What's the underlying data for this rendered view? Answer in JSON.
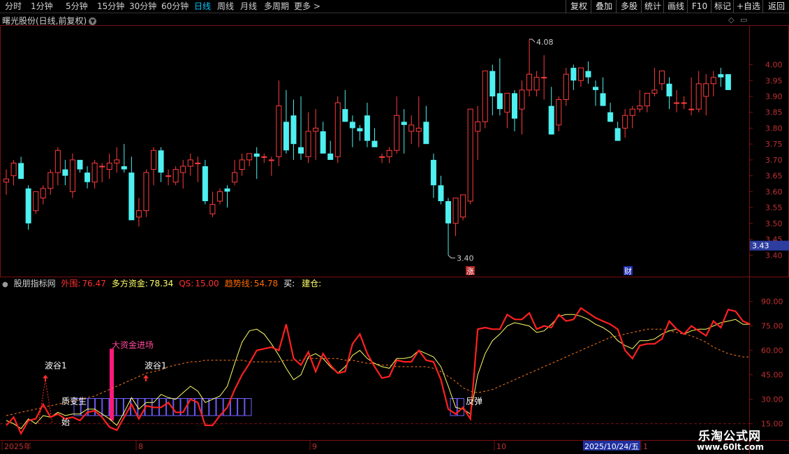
{
  "toolbar": {
    "left_items": [
      "分时",
      "1分钟",
      "5分钟",
      "15分钟",
      "30分钟",
      "60分钟",
      "日线",
      "周线",
      "月线",
      "多周期",
      "更多"
    ],
    "active_item": "日线",
    "right_buttons": [
      "复权",
      "叠加",
      "多股",
      "统计",
      "画线",
      "F10",
      "标记",
      "+自选",
      "返回"
    ]
  },
  "main_chart": {
    "title": "曙光股份(日线,前复权)",
    "price_labels": [
      "4.00",
      "3.95",
      "3.90",
      "3.85",
      "3.80",
      "3.75",
      "3.70",
      "3.65",
      "3.60",
      "3.55",
      "3.50",
      "3.45",
      "3.40"
    ],
    "current_price": "3.43",
    "high_marker": "4.08",
    "low_marker": "3.40",
    "event_badges": [
      "涨",
      "财"
    ],
    "colors": {
      "up": "#ff3c3c",
      "down": "#4ef0f0",
      "current_price_bg": "#2d3ea0"
    }
  },
  "candles": [
    [
      3.63,
      3.67,
      3.59,
      3.64
    ],
    [
      3.65,
      3.7,
      3.62,
      3.69
    ],
    [
      3.69,
      3.71,
      3.64,
      3.64
    ],
    [
      3.61,
      3.62,
      3.48,
      3.5
    ],
    [
      3.54,
      3.6,
      3.53,
      3.6
    ],
    [
      3.58,
      3.62,
      3.56,
      3.61
    ],
    [
      3.61,
      3.67,
      3.59,
      3.66
    ],
    [
      3.66,
      3.74,
      3.62,
      3.73
    ],
    [
      3.67,
      3.7,
      3.62,
      3.65
    ],
    [
      3.6,
      3.72,
      3.58,
      3.7
    ],
    [
      3.7,
      3.69,
      3.66,
      3.67
    ],
    [
      3.66,
      3.68,
      3.61,
      3.63
    ],
    [
      3.63,
      3.7,
      3.61,
      3.69
    ],
    [
      3.68,
      3.69,
      3.63,
      3.68
    ],
    [
      3.67,
      3.72,
      3.64,
      3.69
    ],
    [
      3.69,
      3.74,
      3.66,
      3.7
    ],
    [
      3.68,
      3.75,
      3.66,
      3.67
    ],
    [
      3.66,
      3.71,
      3.64,
      3.51
    ],
    [
      3.52,
      3.58,
      3.49,
      3.54
    ],
    [
      3.54,
      3.67,
      3.52,
      3.66
    ],
    [
      3.67,
      3.74,
      3.62,
      3.73
    ],
    [
      3.73,
      3.74,
      3.63,
      3.66
    ],
    [
      3.65,
      3.67,
      3.62,
      3.65
    ],
    [
      3.63,
      3.68,
      3.62,
      3.67
    ],
    [
      3.66,
      3.7,
      3.61,
      3.68
    ],
    [
      3.68,
      3.72,
      3.65,
      3.7
    ],
    [
      3.69,
      3.71,
      3.63,
      3.69
    ],
    [
      3.68,
      3.7,
      3.56,
      3.57
    ],
    [
      3.53,
      3.6,
      3.52,
      3.56
    ],
    [
      3.57,
      3.61,
      3.56,
      3.6
    ],
    [
      3.61,
      3.62,
      3.55,
      3.6
    ],
    [
      3.63,
      3.7,
      3.62,
      3.66
    ],
    [
      3.67,
      3.72,
      3.65,
      3.7
    ],
    [
      3.7,
      3.72,
      3.68,
      3.72
    ],
    [
      3.72,
      3.74,
      3.64,
      3.71
    ],
    [
      3.71,
      3.72,
      3.69,
      3.71
    ],
    [
      3.7,
      3.71,
      3.65,
      3.7
    ],
    [
      3.71,
      3.95,
      3.68,
      3.87
    ],
    [
      3.82,
      3.92,
      3.72,
      3.73
    ],
    [
      3.84,
      3.89,
      3.7,
      3.75
    ],
    [
      3.74,
      3.9,
      3.7,
      3.72
    ],
    [
      3.71,
      3.85,
      3.69,
      3.79
    ],
    [
      3.79,
      3.86,
      3.7,
      3.8
    ],
    [
      3.79,
      3.82,
      3.72,
      3.72
    ],
    [
      3.72,
      3.76,
      3.7,
      3.7
    ],
    [
      3.71,
      3.9,
      3.69,
      3.88
    ],
    [
      3.86,
      3.92,
      3.82,
      3.82
    ],
    [
      3.82,
      3.84,
      3.74,
      3.8
    ],
    [
      3.8,
      3.81,
      3.76,
      3.79
    ],
    [
      3.84,
      3.88,
      3.74,
      3.76
    ],
    [
      3.76,
      3.8,
      3.74,
      3.74
    ],
    [
      3.71,
      3.72,
      3.69,
      3.71
    ],
    [
      3.71,
      3.74,
      3.69,
      3.73
    ],
    [
      3.73,
      3.9,
      3.72,
      3.84
    ],
    [
      3.82,
      3.86,
      3.72,
      3.81
    ],
    [
      3.79,
      3.84,
      3.75,
      3.81
    ],
    [
      3.79,
      3.9,
      3.74,
      3.8
    ],
    [
      3.82,
      3.87,
      3.75,
      3.75
    ],
    [
      3.7,
      3.72,
      3.58,
      3.62
    ],
    [
      3.62,
      3.65,
      3.56,
      3.57
    ],
    [
      3.57,
      3.58,
      3.4,
      3.5
    ],
    [
      3.5,
      3.58,
      3.46,
      3.58
    ],
    [
      3.52,
      3.59,
      3.51,
      3.59
    ],
    [
      3.57,
      3.86,
      3.56,
      3.86
    ],
    [
      3.79,
      3.87,
      3.7,
      3.82
    ],
    [
      3.82,
      3.95,
      3.8,
      3.98
    ],
    [
      3.98,
      4.0,
      3.84,
      3.9
    ],
    [
      3.91,
      4.02,
      3.84,
      3.86
    ],
    [
      3.85,
      3.91,
      3.8,
      3.91
    ],
    [
      3.91,
      3.92,
      3.79,
      3.83
    ],
    [
      3.86,
      3.95,
      3.78,
      3.92
    ],
    [
      3.92,
      4.08,
      3.9,
      3.97
    ],
    [
      3.92,
      3.98,
      3.9,
      3.96
    ],
    [
      3.96,
      4.03,
      3.89,
      3.96
    ],
    [
      3.87,
      3.93,
      3.78,
      3.78
    ],
    [
      3.81,
      3.9,
      3.79,
      3.89
    ],
    [
      3.89,
      3.99,
      3.87,
      3.97
    ],
    [
      3.99,
      4.0,
      3.92,
      3.95
    ],
    [
      3.95,
      3.99,
      3.93,
      3.99
    ],
    [
      3.98,
      4.01,
      3.94,
      3.96
    ],
    [
      3.93,
      3.95,
      3.87,
      3.92
    ],
    [
      3.91,
      3.96,
      3.87,
      3.87
    ],
    [
      3.85,
      3.88,
      3.82,
      3.82
    ],
    [
      3.8,
      3.82,
      3.76,
      3.76
    ],
    [
      3.8,
      3.86,
      3.77,
      3.84
    ],
    [
      3.84,
      3.87,
      3.8,
      3.86
    ],
    [
      3.86,
      3.92,
      3.85,
      3.87
    ],
    [
      3.87,
      3.91,
      3.85,
      3.91
    ],
    [
      3.91,
      3.99,
      3.9,
      3.92
    ],
    [
      3.94,
      3.98,
      3.92,
      3.98
    ],
    [
      3.94,
      3.96,
      3.86,
      3.9
    ],
    [
      3.88,
      3.92,
      3.85,
      3.88
    ],
    [
      3.88,
      3.9,
      3.86,
      3.88
    ],
    [
      3.86,
      3.96,
      3.84,
      3.86
    ],
    [
      3.86,
      3.98,
      3.85,
      3.94
    ],
    [
      3.9,
      3.97,
      3.84,
      3.94
    ],
    [
      3.94,
      3.98,
      3.9,
      3.96
    ],
    [
      3.97,
      3.99,
      3.93,
      3.96
    ],
    [
      3.97,
      3.96,
      3.92,
      3.92
    ]
  ],
  "indicator": {
    "title": "股朋指标网",
    "fields": [
      {
        "label": "外围:",
        "value": "76.47",
        "color": "#ff3030"
      },
      {
        "label": "多方资金:",
        "value": "78.34",
        "color": "#ffff66"
      },
      {
        "label": "QS:",
        "value": "15.00",
        "color": "#ff3030"
      },
      {
        "label": "趋势线:",
        "value": "54.78",
        "color": "#ff6a00"
      },
      {
        "label": "买:",
        "value": "",
        "color": "#ffffff"
      },
      {
        "label": "建仓:",
        "value": "",
        "color": "#ffff66"
      }
    ],
    "axis_labels": [
      "90.00",
      "75.00",
      "60.00",
      "45.00",
      "30.00",
      "15.00"
    ],
    "annotations": {
      "big_money": "大资金进场",
      "valley1": "波谷1",
      "valley2": "波谷1",
      "begin": "始",
      "rebound": "反弹",
      "mutate": "质变生"
    },
    "red_line": [
      14,
      19,
      9,
      17,
      18,
      27,
      19,
      21,
      18,
      19,
      17,
      22,
      23,
      19,
      13,
      11,
      19,
      27,
      18,
      26,
      25,
      25,
      28,
      22,
      22,
      30,
      28,
      14,
      14,
      20,
      25,
      36,
      45,
      52,
      60,
      61,
      62,
      60,
      76,
      55,
      51,
      59,
      47,
      58,
      51,
      46,
      47,
      64,
      70,
      58,
      50,
      43,
      44,
      54,
      53,
      53,
      60,
      54,
      53,
      42,
      24,
      21,
      25,
      18,
      73,
      74,
      73,
      73,
      82,
      79,
      79,
      83,
      73,
      75,
      74,
      82,
      78,
      79,
      86,
      83,
      80,
      78,
      76,
      73,
      60,
      55,
      63,
      64,
      64,
      67,
      78,
      73,
      70,
      75,
      72,
      69,
      78,
      74,
      85,
      84,
      78,
      76
    ],
    "yellow_line": [
      17,
      15,
      12,
      18,
      15,
      20,
      19,
      22,
      20,
      21,
      21,
      24,
      24,
      21,
      18,
      14,
      22,
      31,
      24,
      28,
      28,
      33,
      31,
      30,
      34,
      38,
      35,
      28,
      30,
      32,
      38,
      52,
      65,
      72,
      73,
      70,
      64,
      57,
      49,
      42,
      45,
      56,
      58,
      55,
      50,
      46,
      50,
      57,
      60,
      55,
      52,
      50,
      49,
      55,
      55,
      56,
      60,
      58,
      56,
      50,
      38,
      25,
      24,
      21,
      45,
      58,
      66,
      70,
      75,
      77,
      76,
      75,
      71,
      72,
      76,
      81,
      82,
      82,
      81,
      79,
      76,
      74,
      71,
      66,
      63,
      61,
      66,
      66,
      67,
      70,
      72,
      73,
      70,
      72,
      73,
      73,
      75,
      77,
      78,
      79,
      76,
      76
    ],
    "trend_line": [
      20,
      21,
      22,
      23,
      24,
      25,
      26,
      27,
      28,
      29,
      30,
      31,
      32,
      34,
      36,
      38,
      40,
      42,
      44,
      46,
      47,
      48,
      50,
      51,
      52,
      53,
      53,
      54,
      54,
      54,
      54,
      54,
      54,
      53,
      53,
      53,
      53,
      53,
      54,
      54,
      54,
      55,
      55,
      55,
      55,
      55,
      54,
      54,
      53,
      52,
      52,
      51,
      51,
      50,
      50,
      50,
      50,
      50,
      49,
      47,
      44,
      41,
      37,
      35,
      34,
      35,
      36,
      38,
      40,
      42,
      44,
      46,
      48,
      50,
      52,
      54,
      56,
      58,
      60,
      62,
      64,
      66,
      68,
      69,
      70,
      71,
      72,
      73,
      73,
      73,
      72,
      71,
      70,
      69,
      67,
      65,
      62,
      60,
      58,
      57,
      56,
      56
    ],
    "box_count": 25,
    "rebound_boxes": 2
  },
  "x_axis": {
    "labels": [
      "2025年",
      "8",
      "9",
      "10",
      "2025/10/24/五",
      "1"
    ]
  },
  "watermark": {
    "line1": "乐淘公式网",
    "line2": "www.60lt.com"
  }
}
